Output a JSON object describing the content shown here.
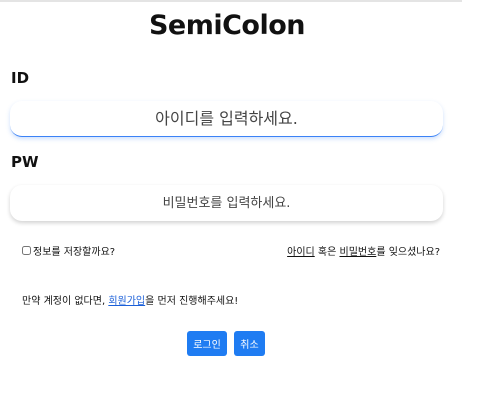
{
  "logo": "SemiColon",
  "id_section": {
    "label": "ID",
    "placeholder": "아이디를 입력하세요."
  },
  "pw_section": {
    "label": "PW",
    "placeholder": "비밀번호를 입력하세요."
  },
  "remember": {
    "label": "정보를 저장할까요?",
    "checked": false
  },
  "forgot": {
    "id_link": "아이디",
    "middle": " 혹은 ",
    "pw_link": "비밀번호",
    "suffix": "를 잊으셨나요?"
  },
  "signup": {
    "prefix": "만약 계정이 없다면, ",
    "link": "회원가입",
    "suffix": "을 먼저 진행해주세요!"
  },
  "buttons": {
    "login": "로그인",
    "cancel": "취소"
  },
  "colors": {
    "accent": "#1f7cf2",
    "link": "#1a5fd8",
    "focus_border": "#3b82f6"
  }
}
